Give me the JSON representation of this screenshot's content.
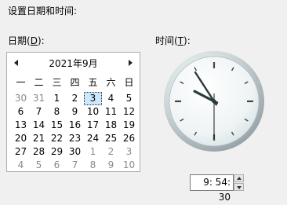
{
  "heading": "设置日期和时间:",
  "date_label": {
    "text": "日期(",
    "mnemonic": "D",
    "suffix": "):"
  },
  "time_label": {
    "text": "时间(",
    "mnemonic": "T",
    "suffix": "):"
  },
  "calendar": {
    "month_title": "2021年9月",
    "weekdays": [
      "一",
      "二",
      "三",
      "四",
      "五",
      "六",
      "日"
    ],
    "days": [
      {
        "n": "30",
        "other": true
      },
      {
        "n": "31",
        "other": true
      },
      {
        "n": "1"
      },
      {
        "n": "2"
      },
      {
        "n": "3",
        "selected": true
      },
      {
        "n": "4"
      },
      {
        "n": "5"
      },
      {
        "n": "6"
      },
      {
        "n": "7"
      },
      {
        "n": "8"
      },
      {
        "n": "9"
      },
      {
        "n": "10"
      },
      {
        "n": "11"
      },
      {
        "n": "12"
      },
      {
        "n": "13"
      },
      {
        "n": "14"
      },
      {
        "n": "15"
      },
      {
        "n": "16"
      },
      {
        "n": "17"
      },
      {
        "n": "18"
      },
      {
        "n": "19"
      },
      {
        "n": "20"
      },
      {
        "n": "21"
      },
      {
        "n": "22"
      },
      {
        "n": "23"
      },
      {
        "n": "24"
      },
      {
        "n": "25"
      },
      {
        "n": "26"
      },
      {
        "n": "27"
      },
      {
        "n": "28"
      },
      {
        "n": "29"
      },
      {
        "n": "30"
      },
      {
        "n": "1",
        "other": true
      },
      {
        "n": "2",
        "other": true
      },
      {
        "n": "3",
        "other": true
      },
      {
        "n": "4",
        "other": true
      },
      {
        "n": "5",
        "other": true
      },
      {
        "n": "6",
        "other": true
      },
      {
        "n": "7",
        "other": true
      },
      {
        "n": "8",
        "other": true
      },
      {
        "n": "9",
        "other": true
      },
      {
        "n": "10",
        "other": true
      }
    ]
  },
  "clock": {
    "hour": 9,
    "minute": 54,
    "second": 30
  },
  "time_field": {
    "value": "9: 54: 30"
  },
  "colors": {
    "selected_day_bg": "#cce8ff",
    "second_hand": "#1a1a1a",
    "clock_hands": "#2a3b40"
  }
}
